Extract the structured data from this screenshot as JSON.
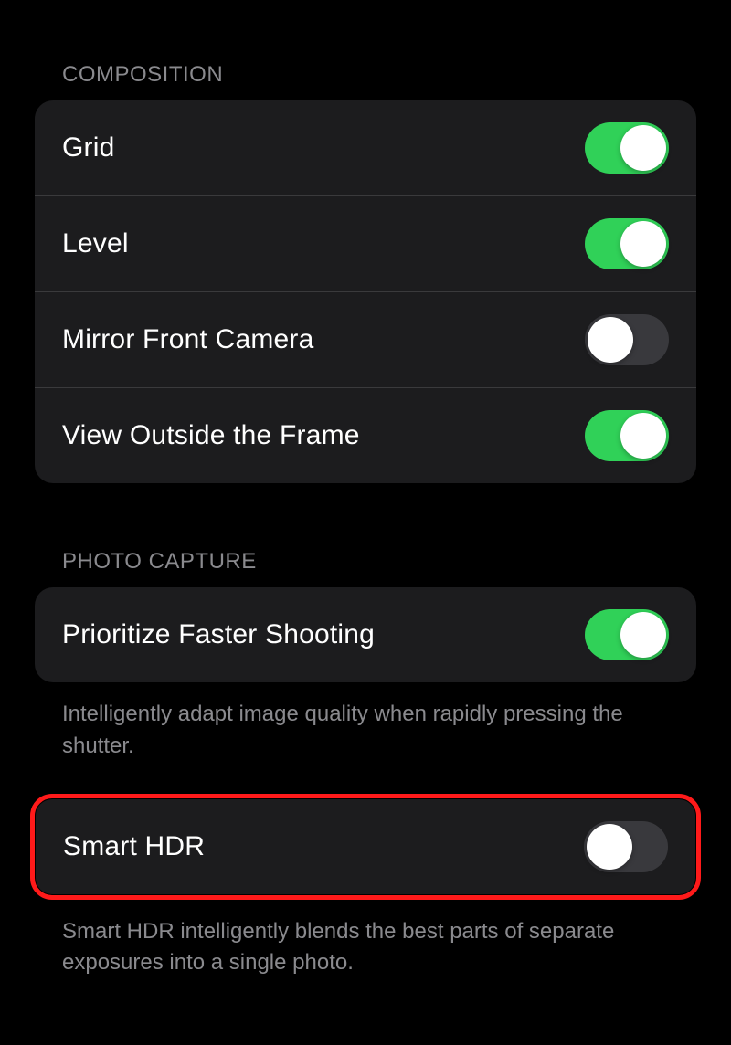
{
  "sections": {
    "composition": {
      "header": "COMPOSITION",
      "items": [
        {
          "label": "Grid",
          "on": true
        },
        {
          "label": "Level",
          "on": true
        },
        {
          "label": "Mirror Front Camera",
          "on": false
        },
        {
          "label": "View Outside the Frame",
          "on": true
        }
      ]
    },
    "photo_capture": {
      "header": "PHOTO CAPTURE",
      "group1": {
        "items": [
          {
            "label": "Prioritize Faster Shooting",
            "on": true
          }
        ],
        "footer": "Intelligently adapt image quality when rapidly pressing the shutter."
      },
      "group2": {
        "highlighted": true,
        "items": [
          {
            "label": "Smart HDR",
            "on": false
          }
        ],
        "footer": "Smart HDR intelligently blends the best parts of separate exposures into a single photo."
      }
    }
  }
}
